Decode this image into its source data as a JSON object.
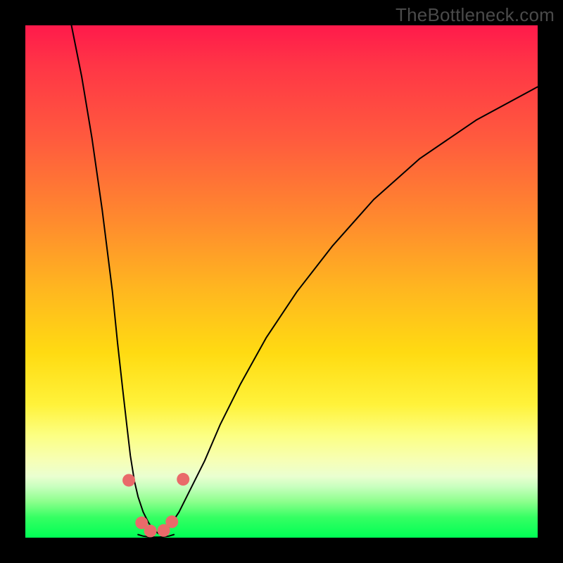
{
  "watermark": "TheBottleneck.com",
  "chart_data": {
    "type": "line",
    "title": "",
    "xlabel": "",
    "ylabel": "",
    "xlim": [
      0,
      100
    ],
    "ylim": [
      0,
      100
    ],
    "series": [
      {
        "name": "left-branch",
        "x": [
          9,
          11,
          13,
          15,
          17,
          18,
          19,
          19.8,
          20.5,
          21.3,
          22,
          23,
          24,
          25,
          26
        ],
        "values": [
          100,
          90,
          78,
          64,
          48,
          38,
          29,
          22,
          16,
          11,
          8,
          5,
          3,
          1.5,
          0.8
        ]
      },
      {
        "name": "right-branch",
        "x": [
          27,
          28,
          30,
          32,
          35,
          38,
          42,
          47,
          53,
          60,
          68,
          77,
          88,
          100
        ],
        "values": [
          0.8,
          2,
          5,
          9,
          15,
          22,
          30,
          39,
          48,
          57,
          66,
          74,
          81.5,
          88
        ]
      },
      {
        "name": "valley-floor",
        "x": [
          22,
          23,
          24,
          25,
          26,
          27,
          28,
          29
        ],
        "values": [
          0.6,
          0.3,
          0.15,
          0.1,
          0.1,
          0.15,
          0.3,
          0.6
        ]
      }
    ],
    "markers": {
      "name": "highlighted-points",
      "color": "#e96a6a",
      "points": [
        {
          "x": 20.2,
          "y": 11.2
        },
        {
          "x": 22.7,
          "y": 2.9
        },
        {
          "x": 24.4,
          "y": 1.3
        },
        {
          "x": 27.0,
          "y": 1.4
        },
        {
          "x": 28.6,
          "y": 3.1
        },
        {
          "x": 30.8,
          "y": 11.4
        }
      ]
    }
  }
}
